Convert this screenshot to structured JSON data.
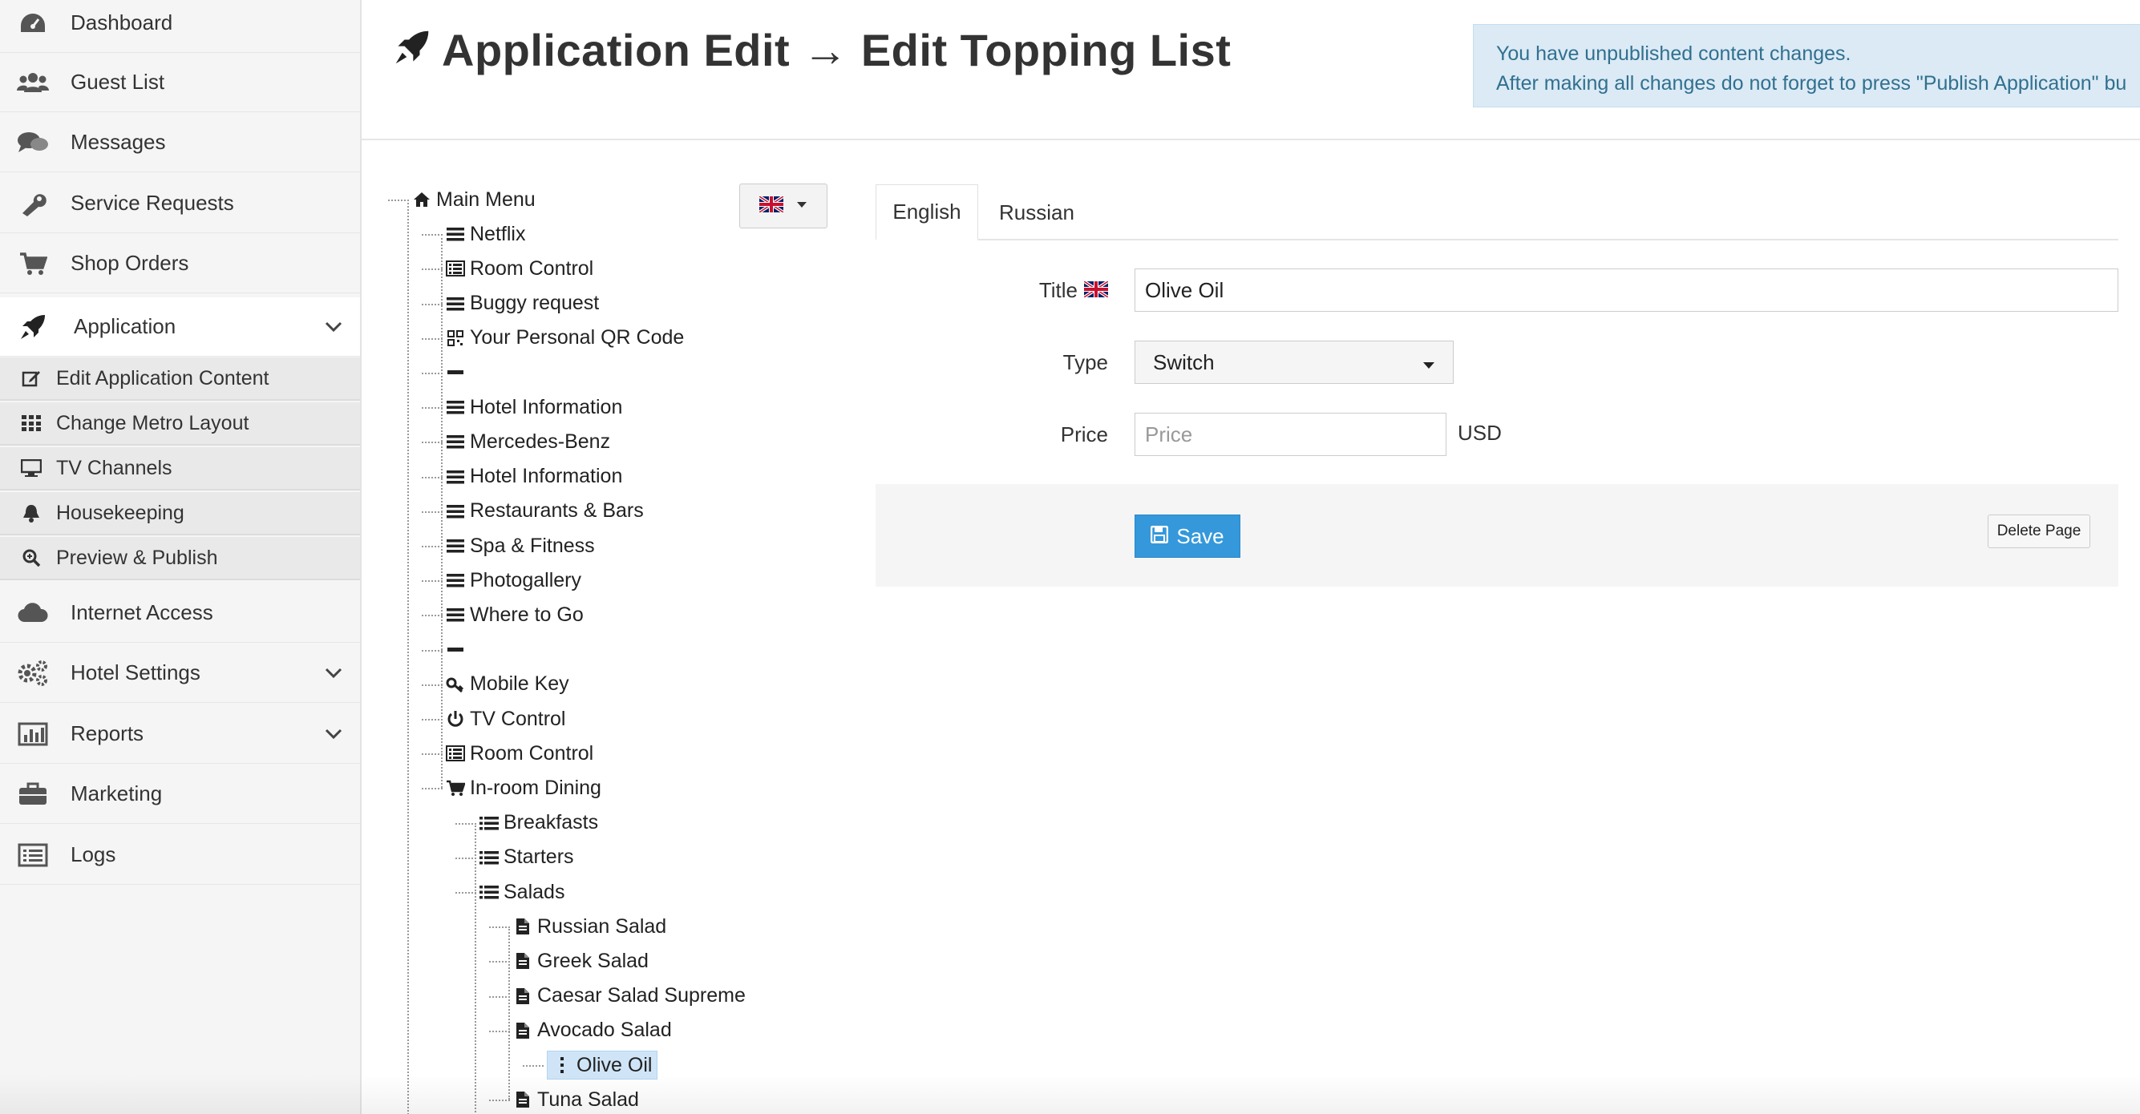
{
  "sidebar": {
    "items": [
      {
        "label": "Dashboard",
        "icon": "dashboard-icon"
      },
      {
        "label": "Guest List",
        "icon": "users-icon"
      },
      {
        "label": "Messages",
        "icon": "comments-icon"
      },
      {
        "label": "Service Requests",
        "icon": "wrench-icon"
      },
      {
        "label": "Shop Orders",
        "icon": "cart-icon"
      },
      {
        "label": "Application",
        "icon": "rocket-icon",
        "expanded": true
      },
      {
        "label": "Internet Access",
        "icon": "cloud-icon"
      },
      {
        "label": "Hotel Settings",
        "icon": "gears-icon"
      },
      {
        "label": "Reports",
        "icon": "bar-chart-icon"
      },
      {
        "label": "Marketing",
        "icon": "briefcase-icon"
      },
      {
        "label": "Logs",
        "icon": "list-icon"
      }
    ],
    "subitems": [
      {
        "label": "Edit Application Content",
        "icon": "edit-icon"
      },
      {
        "label": "Change Metro Layout",
        "icon": "grid-icon"
      },
      {
        "label": "TV Channels",
        "icon": "monitor-icon"
      },
      {
        "label": "Housekeeping",
        "icon": "bell-icon"
      },
      {
        "label": "Preview & Publish",
        "icon": "zoom-icon"
      }
    ]
  },
  "header": {
    "title": "Application Edit → Edit Topping List",
    "alert_line1": "You have unpublished content changes.",
    "alert_line2": "After making all changes do not forget to press \"Publish Application\" bu"
  },
  "tree": {
    "nodes": [
      {
        "label": "Main Menu",
        "icon": "home-icon",
        "level": 0
      },
      {
        "label": "Netflix",
        "icon": "menu-icon",
        "level": 1
      },
      {
        "label": "Room Control",
        "icon": "list-alt-icon",
        "level": 1
      },
      {
        "label": "Buggy request",
        "icon": "menu-icon",
        "level": 1
      },
      {
        "label": "Your Personal QR Code",
        "icon": "qrcode-icon",
        "level": 1
      },
      {
        "label": "",
        "icon": "separator-icon",
        "level": 1
      },
      {
        "label": "Hotel Information",
        "icon": "menu-icon",
        "level": 1
      },
      {
        "label": "Mercedes-Benz",
        "icon": "menu-icon",
        "level": 1
      },
      {
        "label": "Hotel Information",
        "icon": "menu-icon",
        "level": 1
      },
      {
        "label": "Restaurants & Bars",
        "icon": "menu-icon",
        "level": 1
      },
      {
        "label": "Spa & Fitness",
        "icon": "menu-icon",
        "level": 1
      },
      {
        "label": "Photogallery",
        "icon": "menu-icon",
        "level": 1
      },
      {
        "label": "Where to Go",
        "icon": "menu-icon",
        "level": 1
      },
      {
        "label": "",
        "icon": "separator-icon",
        "level": 1
      },
      {
        "label": "Mobile Key",
        "icon": "key-icon",
        "level": 1
      },
      {
        "label": "TV Control",
        "icon": "power-icon",
        "level": 1
      },
      {
        "label": "Room Control",
        "icon": "list-alt-icon",
        "level": 1
      },
      {
        "label": "In-room Dining",
        "icon": "cart-icon",
        "level": 1
      },
      {
        "label": "Breakfasts",
        "icon": "list-ul-icon",
        "level": 2
      },
      {
        "label": "Starters",
        "icon": "list-ul-icon",
        "level": 2
      },
      {
        "label": "Salads",
        "icon": "list-ul-icon",
        "level": 2
      },
      {
        "label": "Russian Salad",
        "icon": "file-icon",
        "level": 3
      },
      {
        "label": "Greek Salad",
        "icon": "file-icon",
        "level": 3
      },
      {
        "label": "Caesar Salad Supreme",
        "icon": "file-icon",
        "level": 3
      },
      {
        "label": "Avocado Salad",
        "icon": "file-icon",
        "level": 3
      },
      {
        "label": "Olive Oil",
        "icon": "vertical-ellipsis-icon",
        "level": 4,
        "selected": true
      },
      {
        "label": "Tuna Salad",
        "icon": "file-icon",
        "level": 3
      }
    ],
    "language_flag": "uk-flag-icon"
  },
  "form": {
    "tabs": [
      "English",
      "Russian"
    ],
    "active_tab": "English",
    "title_label": "Title",
    "title_value": "Olive Oil",
    "type_label": "Type",
    "type_value": "Switch",
    "price_label": "Price",
    "price_placeholder": "Price",
    "price_unit": "USD",
    "save_label": "Save",
    "delete_label": "Delete Page"
  },
  "colors": {
    "accent": "#3498db",
    "alert_bg": "#dbeaf5",
    "alert_text": "#31708f",
    "selected_bg": "#cfe5f7"
  }
}
